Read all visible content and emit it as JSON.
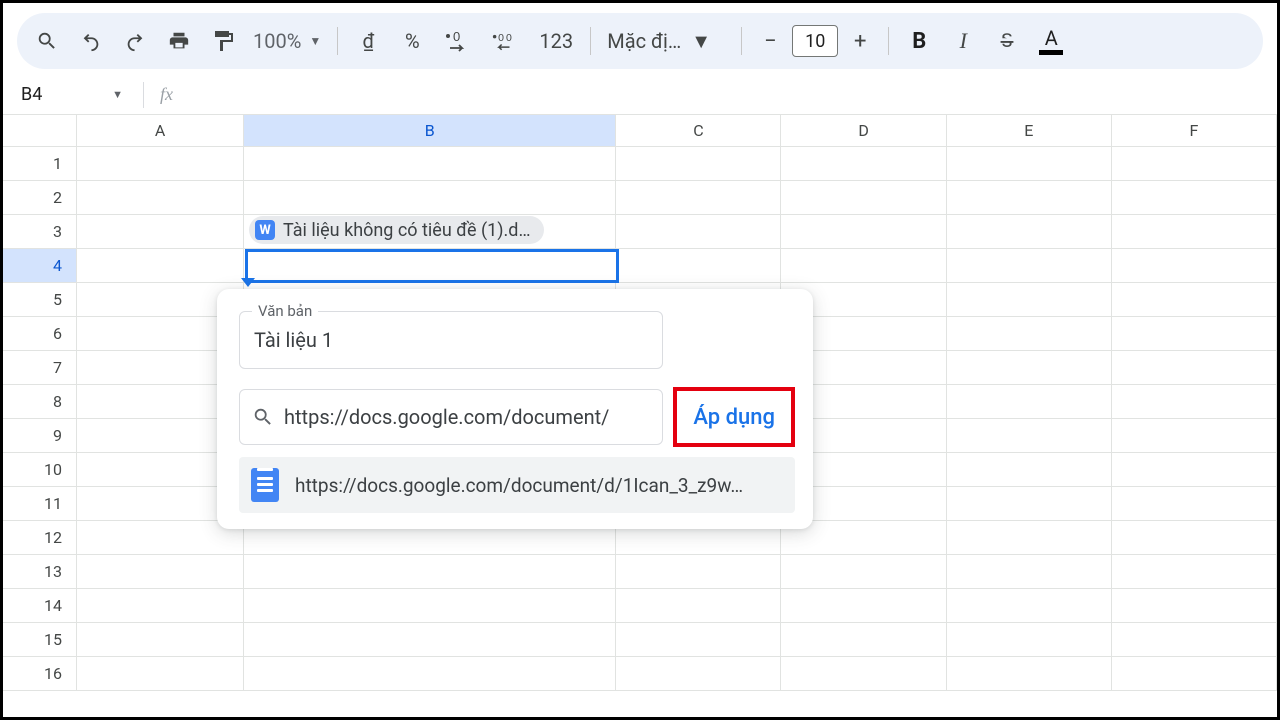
{
  "toolbar": {
    "zoom": "100%",
    "currency_symbol": "₫",
    "percent": "%",
    "n123": "123",
    "font_label": "Mặc đị…",
    "font_size": "10"
  },
  "namebox": {
    "ref": "B4"
  },
  "columns": [
    "A",
    "B",
    "C",
    "D",
    "E",
    "F"
  ],
  "rows": [
    "1",
    "2",
    "3",
    "4",
    "5",
    "6",
    "7",
    "8",
    "9",
    "10",
    "11",
    "12",
    "13",
    "14",
    "15",
    "16"
  ],
  "chip": {
    "icon_letter": "W",
    "label": "Tài liệu không có tiêu đề (1).d…"
  },
  "popup": {
    "text_label": "Văn bản",
    "text_value": "Tài liệu 1",
    "link_value": "https://docs.google.com/document/",
    "apply_label": "Áp dụng",
    "suggestion": "https://docs.google.com/document/d/1Ican_3_z9w…"
  }
}
